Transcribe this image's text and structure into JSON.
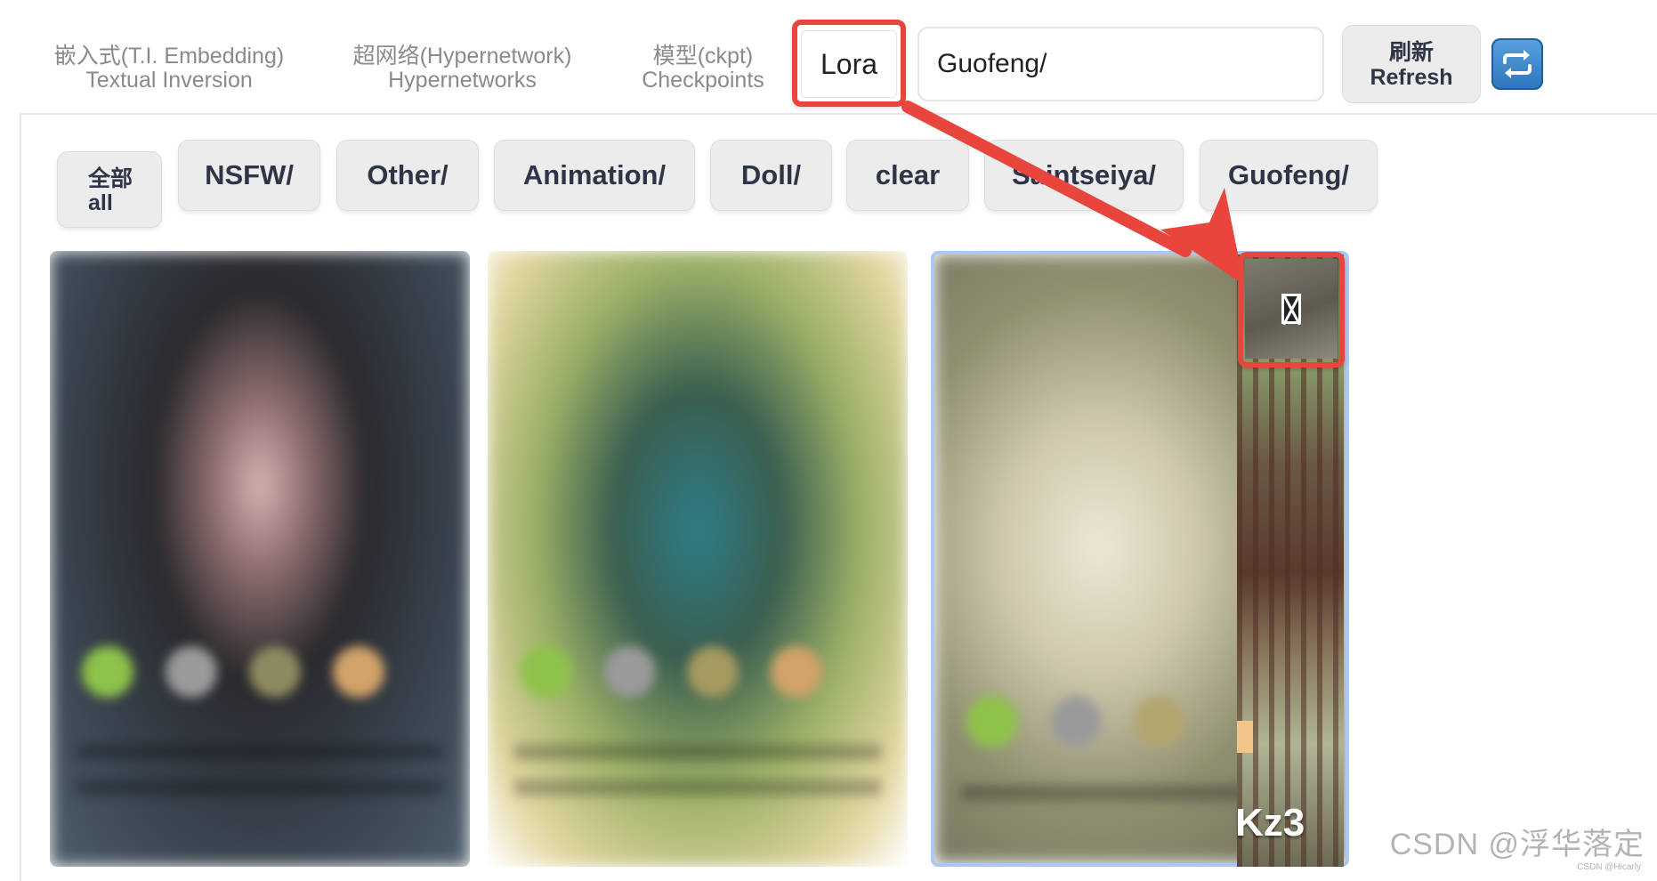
{
  "tabs": [
    {
      "line1": "嵌入式(T.I. Embedding)",
      "line2": "Textual Inversion"
    },
    {
      "line1": "超网络(Hypernetwork)",
      "line2": "Hypernetworks"
    },
    {
      "line1": "模型(ckpt)",
      "line2": "Checkpoints"
    }
  ],
  "active_tab": "Lora",
  "search": {
    "value": "Guofeng/"
  },
  "refresh": {
    "line1": "刷新",
    "line2": "Refresh"
  },
  "filters": {
    "all": {
      "line1": "全部",
      "line2": "all"
    },
    "items": [
      "NSFW/",
      "Other/",
      "Animation/",
      "Doll/",
      "clear",
      "Saintseiya/",
      "Guofeng/"
    ]
  },
  "cards": [
    {
      "id": "card-1"
    },
    {
      "id": "card-2"
    },
    {
      "id": "card-3",
      "label": "Kz3"
    }
  ],
  "annotation_color": "#e8463c",
  "watermark": {
    "main": "CSDN @浮华落定",
    "small": "CSDN @Hicarly"
  }
}
